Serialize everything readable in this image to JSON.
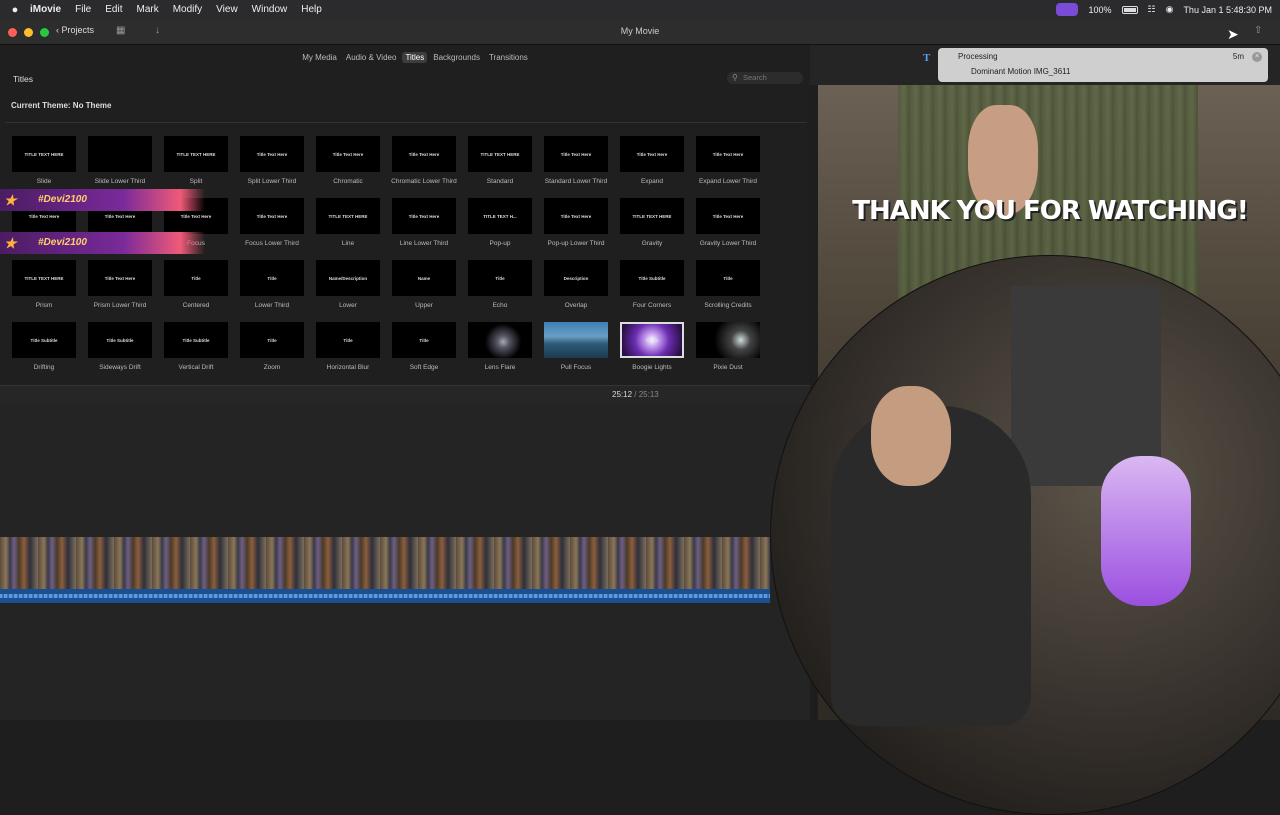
{
  "menubar": {
    "apple": "",
    "app": "iMovie",
    "items": [
      "File",
      "Edit",
      "Mark",
      "Modify",
      "View",
      "Window",
      "Help"
    ],
    "battery": "100%",
    "clock": "Thu Jan 1  5:48:30 PM"
  },
  "window": {
    "title": "My Movie",
    "projects_label": "Projects"
  },
  "browser": {
    "tabs": [
      "My Media",
      "Audio & Video",
      "Titles",
      "Backgrounds",
      "Transitions"
    ],
    "active_tab": "Titles",
    "section_title": "Titles",
    "search_placeholder": "Search",
    "theme": "Current Theme: No Theme",
    "tiles": [
      {
        "label": "Slide",
        "thumb": "TITLE TEXT HERE"
      },
      {
        "label": "Slide Lower Third",
        "thumb": ""
      },
      {
        "label": "Split",
        "thumb": "TITLE TEXT HERE"
      },
      {
        "label": "Split Lower Third",
        "thumb": "Title Text Here"
      },
      {
        "label": "Chromatic",
        "thumb": "Title Text Here"
      },
      {
        "label": "Chromatic Lower Third",
        "thumb": "Title Text Here"
      },
      {
        "label": "Standard",
        "thumb": "TITLE TEXT HERE"
      },
      {
        "label": "Standard Lower Third",
        "thumb": "Title Text Here"
      },
      {
        "label": "Expand",
        "thumb": "Title Text Here"
      },
      {
        "label": "Expand Lower Third",
        "thumb": "Title Text Here"
      },
      {
        "label": "Focus",
        "thumb": "Title Text Here"
      },
      {
        "label": "Focus",
        "thumb": "Title Text Here"
      },
      {
        "label": "Focus",
        "thumb": "Title Text Here"
      },
      {
        "label": "Focus Lower Third",
        "thumb": "Title Text Here"
      },
      {
        "label": "Line",
        "thumb": "TITLE TEXT HERE"
      },
      {
        "label": "Line Lower Third",
        "thumb": "Title Text Here"
      },
      {
        "label": "Pop-up",
        "thumb": "TITLE TEXT H..."
      },
      {
        "label": "Pop-up Lower Third",
        "thumb": "Title Text Here"
      },
      {
        "label": "Gravity",
        "thumb": "TITLE TEXT HERE"
      },
      {
        "label": "Gravity Lower Third",
        "thumb": "Title Text Here"
      },
      {
        "label": "Prism",
        "thumb": "TITLE TEXT HERE"
      },
      {
        "label": "Prism Lower Third",
        "thumb": "Title Text Here"
      },
      {
        "label": "Centered",
        "thumb": "Title"
      },
      {
        "label": "Lower Third",
        "thumb": "Title"
      },
      {
        "label": "Lower",
        "thumb": "Name/Description"
      },
      {
        "label": "Upper",
        "thumb": "Name"
      },
      {
        "label": "Echo",
        "thumb": "Title"
      },
      {
        "label": "Overlap",
        "thumb": "Description"
      },
      {
        "label": "Four Corners",
        "thumb": "Title Subtitle"
      },
      {
        "label": "Scrolling Credits",
        "thumb": "Title"
      },
      {
        "label": "Drifting",
        "thumb": "Title Subtitle"
      },
      {
        "label": "Sideways Drift",
        "thumb": "Title Subtitle"
      },
      {
        "label": "Vertical Drift",
        "thumb": "Title Subtitle"
      },
      {
        "label": "Zoom",
        "thumb": "Title"
      },
      {
        "label": "Horizontal Blur",
        "thumb": "Title"
      },
      {
        "label": "Soft Edge",
        "thumb": "Title"
      },
      {
        "label": "Lens Flare",
        "thumb": ""
      },
      {
        "label": "Pull Focus",
        "thumb": ""
      },
      {
        "label": "Boogie Lights",
        "thumb": "TITLE"
      },
      {
        "label": "Pixie Dust",
        "thumb": ""
      }
    ],
    "overlay_banner": "#Devi2100"
  },
  "viewer": {
    "current_time": "25:12",
    "separator": "/",
    "total_time": "25:13"
  },
  "processing": {
    "title": "Processing",
    "item": "Dominant Motion IMG_3611",
    "time_left": "5m"
  },
  "video": {
    "caption": "THANK YOU FOR WATCHING!"
  }
}
